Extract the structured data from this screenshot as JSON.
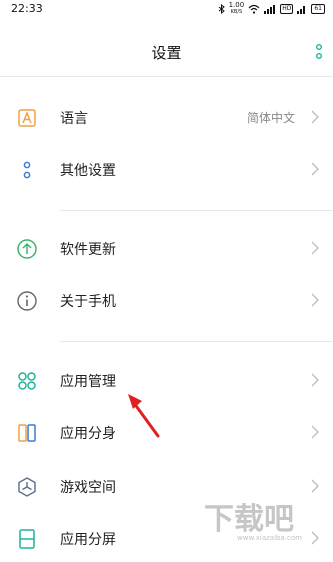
{
  "status": {
    "time": "22:33",
    "speed_value": "1.00",
    "speed_unit": "KB/S",
    "hd": "HD",
    "battery": "61"
  },
  "header": {
    "title": "设置",
    "more_icon": "more-vertical-icon"
  },
  "items": [
    {
      "label": "语言",
      "value": "简体中文",
      "icon": "language-icon"
    },
    {
      "label": "其他设置",
      "icon": "other-settings-icon"
    },
    {
      "label": "软件更新",
      "icon": "update-icon"
    },
    {
      "label": "关于手机",
      "icon": "info-icon"
    },
    {
      "label": "应用管理",
      "icon": "apps-grid-icon"
    },
    {
      "label": "应用分身",
      "icon": "dual-apps-icon"
    },
    {
      "label": "游戏空间",
      "icon": "game-space-icon"
    },
    {
      "label": "应用分屏",
      "icon": "split-screen-icon"
    }
  ],
  "colors": {
    "accent": "#1fb29c",
    "orange": "#f0a040",
    "green": "#3cb371",
    "arrow": "#e02020"
  },
  "watermark": {
    "text": "下载吧",
    "url_text": "www.xiazaiba.com"
  }
}
